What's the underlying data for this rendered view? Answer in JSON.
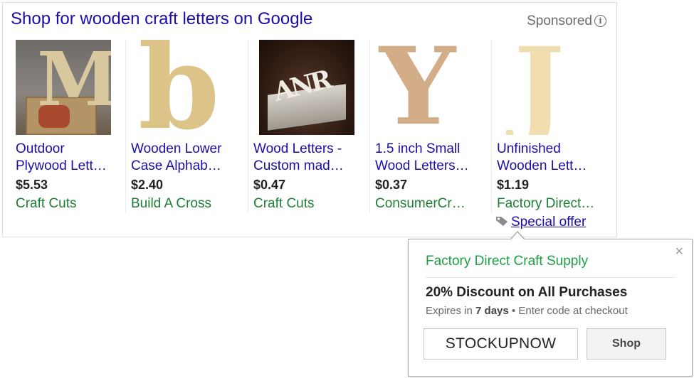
{
  "header": {
    "title": "Shop for wooden craft letters on Google",
    "sponsored_label": "Sponsored",
    "info_glyph": "i"
  },
  "products": [
    {
      "title_line1": "Outdoor",
      "title_line2": "Plywood Lett…",
      "price": "$5.53",
      "seller": "Craft Cuts",
      "thumb_letter": "M"
    },
    {
      "title_line1": "Wooden Lower",
      "title_line2": "Case Alphab…",
      "price": "$2.40",
      "seller": "Build A Cross",
      "thumb_letter": "b"
    },
    {
      "title_line1": "Wood Letters -",
      "title_line2": "Custom mad…",
      "price": "$0.47",
      "seller": "Craft Cuts",
      "thumb_letter": "ANR"
    },
    {
      "title_line1": "1.5 inch Small",
      "title_line2": "Wood Letters…",
      "price": "$0.37",
      "seller": "ConsumerCr…",
      "thumb_letter": "Y"
    },
    {
      "title_line1": "Unfinished",
      "title_line2": "Wooden Lett…",
      "price": "$1.19",
      "seller": "Factory Direct…",
      "thumb_letter": "J"
    }
  ],
  "special_offer": {
    "label": "Special offer",
    "icon": "tag-icon"
  },
  "popup": {
    "close_glyph": "×",
    "merchant": "Factory Direct Craft Supply",
    "offer": "20% Discount on All Purchases",
    "expires_prefix": "Expires in",
    "expires_value": "7 days",
    "separator": "•",
    "instruction": "Enter code at checkout",
    "code": "STOCKUPNOW",
    "shop_label": "Shop"
  },
  "colors": {
    "link": "#1a0dab",
    "seller": "#1e7e34",
    "merchant": "#1e9e44"
  }
}
